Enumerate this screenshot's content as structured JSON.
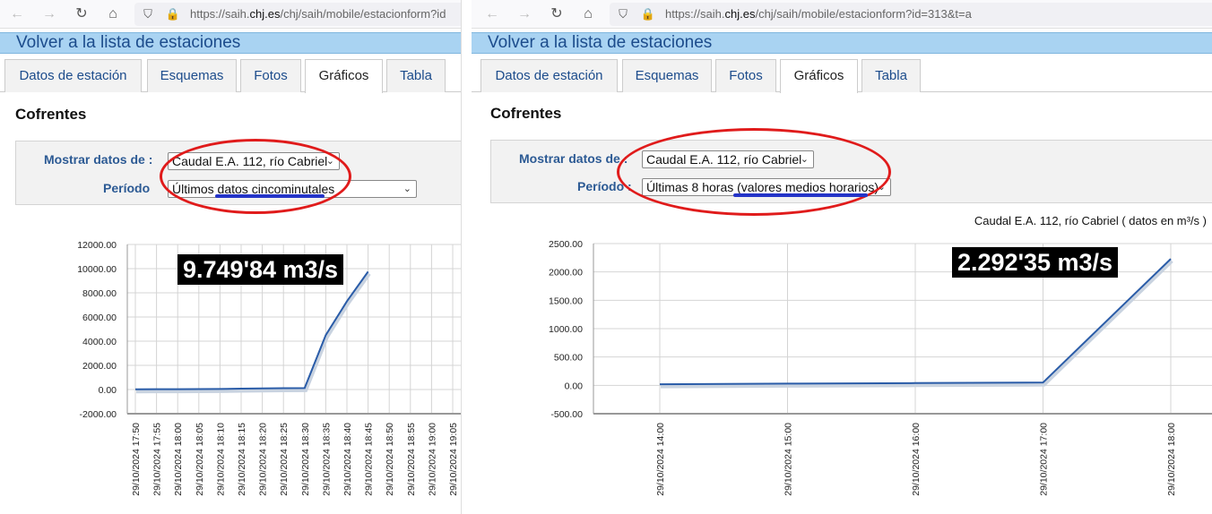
{
  "panels": [
    {
      "url": {
        "prefix": "https://saih.",
        "domain": "chj.es",
        "path": "/chj/saih/mobile/estacionform?id"
      },
      "back_label": "Volver a la lista de estaciones",
      "tabs": [
        "Datos de estación",
        "Esquemas",
        "Fotos",
        "Gráficos",
        "Tabla"
      ],
      "active_tab": "Gráficos",
      "station": "Cofrentes",
      "filters": {
        "show_label": "Mostrar datos de :",
        "show_value": "Caudal E.A. 112, río Cabriel",
        "period_label": "Período",
        "period_value": "Últimos datos cincominutales"
      },
      "chart_caption": "",
      "annotation": "9.749'84 m3/s",
      "chart_data": {
        "type": "line",
        "x": [
          "29/10/2024 17:50",
          "29/10/2024 17:55",
          "29/10/2024 18:00",
          "29/10/2024 18:05",
          "29/10/2024 18:10",
          "29/10/2024 18:15",
          "29/10/2024 18:20",
          "29/10/2024 18:25",
          "29/10/2024 18:30",
          "29/10/2024 18:35",
          "29/10/2024 18:40",
          "29/10/2024 18:45",
          "29/10/2024 18:50",
          "29/10/2024 18:55",
          "29/10/2024 19:00",
          "29/10/2024 19:05"
        ],
        "values": [
          20,
          25,
          30,
          40,
          50,
          70,
          90,
          110,
          120,
          4500,
          7300,
          9749.84,
          null,
          null,
          null,
          null
        ],
        "yticks": [
          "12000.00",
          "10000.00",
          "8000.00",
          "6000.00",
          "4000.00",
          "2000.00",
          "0.00",
          "-2000.00"
        ],
        "ylim": [
          -2000,
          12000
        ],
        "grid": true,
        "color": "#2a5ca8"
      }
    },
    {
      "url": {
        "prefix": "https://saih.",
        "domain": "chj.es",
        "path": "/chj/saih/mobile/estacionform?id=313&t=a"
      },
      "back_label": "Volver a la lista de estaciones",
      "tabs": [
        "Datos de estación",
        "Esquemas",
        "Fotos",
        "Gráficos",
        "Tabla"
      ],
      "active_tab": "Gráficos",
      "station": "Cofrentes",
      "filters": {
        "show_label": "Mostrar datos de :",
        "show_value": "Caudal E.A. 112, río Cabriel",
        "period_label": "Período :",
        "period_value": "Últimas 8 horas (valores medios horarios)"
      },
      "chart_caption": "Caudal E.A. 112, río Cabriel ( datos en m³/s )",
      "annotation": "2.292'35 m3/s",
      "chart_data": {
        "type": "line",
        "x": [
          "29/10/2024 14:00",
          "29/10/2024 15:00",
          "29/10/2024 16:00",
          "29/10/2024 17:00",
          "29/10/2024 18:00"
        ],
        "values": [
          20,
          30,
          40,
          50,
          2230
        ],
        "yticks": [
          "2500.00",
          "2000.00",
          "1500.00",
          "1000.00",
          "500.00",
          "0.00",
          "-500.00"
        ],
        "ylim": [
          -500,
          2500
        ],
        "grid": true,
        "color": "#2a5ca8"
      }
    }
  ]
}
